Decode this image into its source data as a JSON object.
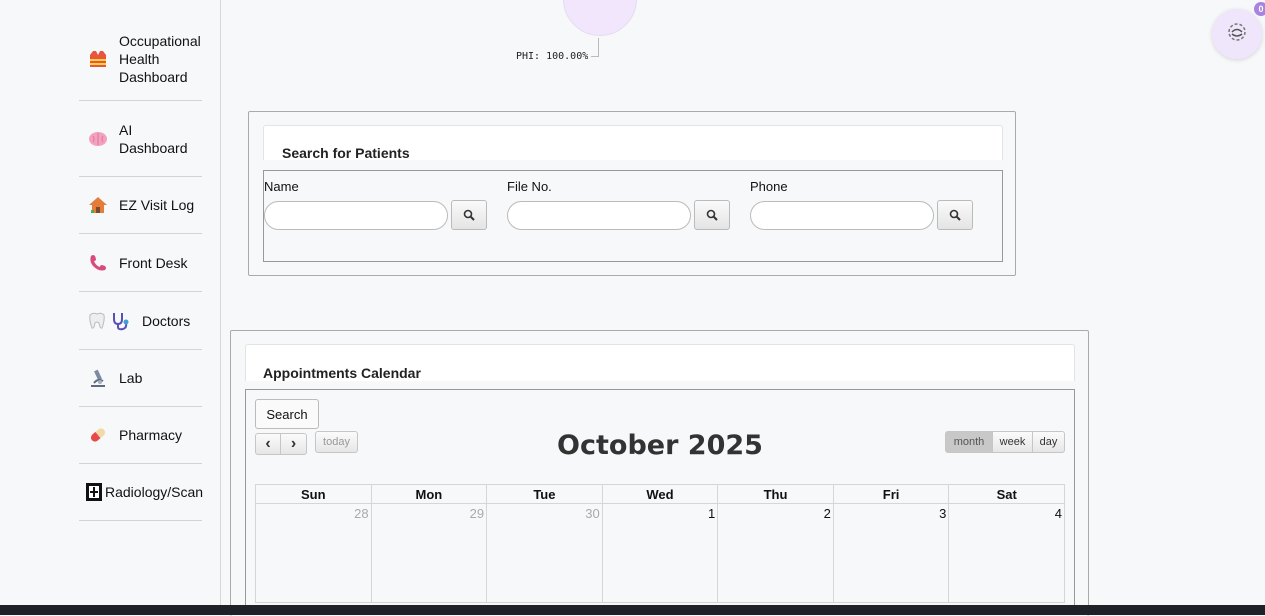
{
  "sidebar": {
    "items": [
      {
        "label": "Occupational Health Dashboard",
        "icon": "safety-vest-icon"
      },
      {
        "label": "AI Dashboard",
        "icon": "brain-icon"
      },
      {
        "label": "EZ Visit Log",
        "icon": "house-icon"
      },
      {
        "label": "Front Desk",
        "icon": "phone-icon"
      },
      {
        "label": "Doctors",
        "icon": "tooth-stethoscope-icon"
      },
      {
        "label": "Lab",
        "icon": "microscope-icon"
      },
      {
        "label": "Pharmacy",
        "icon": "pill-icon"
      },
      {
        "label": "Radiology/Scan",
        "icon": "hospital-icon"
      }
    ]
  },
  "phi_label": "PHI: 100.00%",
  "widget": {
    "badge": "0"
  },
  "search_panel": {
    "title": "Search for Patients",
    "fields": [
      {
        "label": "Name",
        "placeholder": ""
      },
      {
        "label": "File No.",
        "placeholder": ""
      },
      {
        "label": "Phone",
        "placeholder": ""
      }
    ]
  },
  "calendar": {
    "panel_title": "Appointments Calendar",
    "search_button": "Search",
    "prev": "‹",
    "next": "›",
    "today": "today",
    "title": "October 2025",
    "views": {
      "month": "month",
      "week": "week",
      "day": "day"
    },
    "weekdays": [
      "Sun",
      "Mon",
      "Tue",
      "Wed",
      "Thu",
      "Fri",
      "Sat"
    ],
    "first_week": [
      "28",
      "29",
      "30",
      "1",
      "2",
      "3",
      "4"
    ]
  },
  "colors": {
    "accent_purple": "#efe6fb",
    "badge": "#a884e0"
  }
}
